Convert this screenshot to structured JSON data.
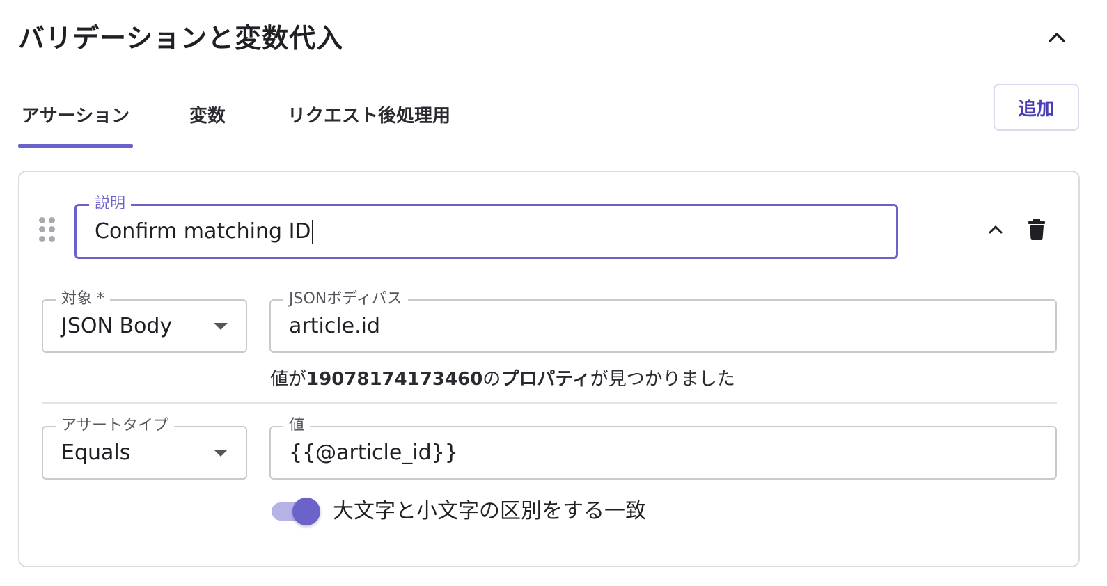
{
  "section": {
    "title": "バリデーションと変数代入"
  },
  "tabs": [
    {
      "label": "アサーション",
      "active": true
    },
    {
      "label": "変数",
      "active": false
    },
    {
      "label": "リクエスト後処理用",
      "active": false
    }
  ],
  "toolbar": {
    "add_label": "追加"
  },
  "assertion": {
    "description": {
      "label": "説明",
      "value": "Confirm matching ID"
    },
    "target": {
      "label": "対象 *",
      "value": "JSON Body"
    },
    "json_path": {
      "label": "JSONボディパス",
      "value": "article.id"
    },
    "helper": {
      "prefix": "値が",
      "value": "19078174173460",
      "middle": "の",
      "keyword": "プロパティ",
      "suffix": "が見つかりました"
    },
    "assert_type": {
      "label": "アサートタイプ",
      "value": "Equals"
    },
    "expected": {
      "label": "値",
      "value": "{{@article_id}}"
    },
    "case_sensitive": {
      "label": "大文字と小文字の区別をする一致",
      "enabled": true
    }
  },
  "colors": {
    "accent": "#6b63c9",
    "accent_light": "#b7b2e6",
    "border": "#c9c9cf",
    "text": "#1f1f24",
    "button_text": "#4b3fb5"
  },
  "icons": {
    "collapse_section": "chevron-up-icon",
    "collapse_item": "chevron-up-icon",
    "delete": "trash-icon",
    "drag": "drag-handle-icon"
  }
}
